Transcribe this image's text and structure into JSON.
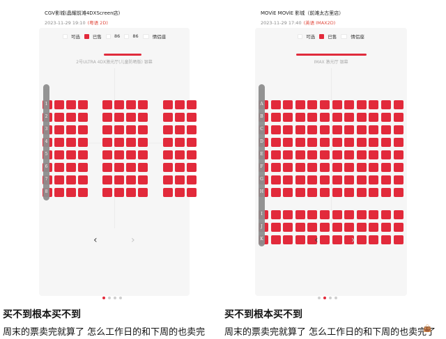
{
  "colors": {
    "sold": "#e22a3b",
    "accent": "#e0493d",
    "rail": "#8e8e8e"
  },
  "left": {
    "cinema_name": "CGV影城(晶耀前滩4DXScreen店)",
    "show_time": "2023-11-29 19:10",
    "format": "(粤语 2D)",
    "legend": {
      "available": "可选",
      "sold": "已售",
      "seat_a": "86",
      "seat_b": "86",
      "couple": "情侣座"
    },
    "hall_name": "2号ULTRA 4DX激光厅(儿童防晒版) 银幕",
    "row_labels": [
      "1",
      "2",
      "3",
      "4",
      "5",
      "6",
      "7",
      "8"
    ],
    "nav": {
      "prev": "‹",
      "next": "›"
    },
    "caption_title": "买不到根本买不到",
    "caption_body": "周末的票卖完就算了 怎么工作日的和下周的也卖完"
  },
  "right": {
    "cinema_name": "MOViE MOViE 影城（前滩太古里店）",
    "show_time": "2023-11-29 17:40",
    "format": "(英语 IMAX2D)",
    "legend": {
      "available": "可选",
      "sold": "已售",
      "couple": "情侣座"
    },
    "hall_name": "IMAX 激光厅 银幕",
    "row_labels": [
      "A",
      "B",
      "C",
      "D",
      "E",
      "F",
      "G",
      "H",
      "I",
      "J",
      "K"
    ],
    "nav": {
      "prev": "‹",
      "next": "›"
    },
    "caption_title": "买不到根本买不到",
    "caption_body": "周末的票卖完就算了 怎么工作日的和下周的也卖完了",
    "emoji": "👜"
  }
}
